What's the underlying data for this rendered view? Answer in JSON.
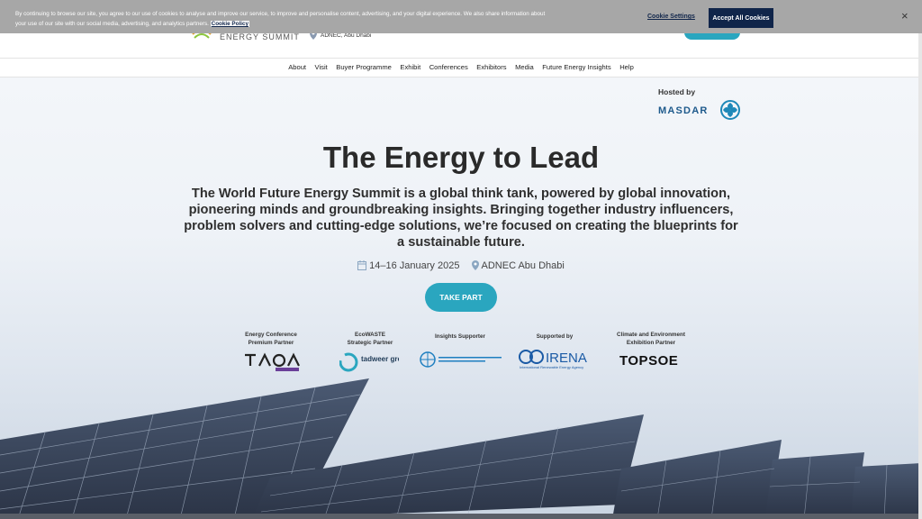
{
  "cookie_banner": {
    "text": "By continuing to browse our site, you agree to our use of cookies to analyse and improve our service, to improve and personalise content, advertising, and your digital experience. We also share information about your use of our site with our social media, advertising, and analytics partners.",
    "policy_link": "Cookie Policy",
    "settings_label": "Cookie Settings",
    "accept_label": "Accept All Cookies",
    "close_label": "×"
  },
  "header": {
    "logo_text": "ENERGY SUMMIT",
    "location": "ADNEC, Abu Dhabi"
  },
  "nav": {
    "items": [
      "About",
      "Visit",
      "Buyer Programme",
      "Exhibit",
      "Conferences",
      "Exhibitors",
      "Media",
      "Future Energy Insights",
      "Help"
    ]
  },
  "host": {
    "label": "Hosted by",
    "name": "MASDAR"
  },
  "hero": {
    "title": "The Energy to Lead",
    "description": "The World Future Energy Summit is a global think tank, powered by global innovation, pioneering minds and groundbreaking insights. Bringing together industry influencers, problem solvers and cutting-edge solutions, we’re focused on creating the blueprints for a sustainable future.",
    "dates": "14–16 January 2025",
    "venue": "ADNEC Abu Dhabi",
    "cta_label": "TAKE PART"
  },
  "partners": [
    {
      "caption_1": "Energy Conference",
      "caption_2": "Premium Partner",
      "logo": "TAQA"
    },
    {
      "caption_1": "EcoWASTE",
      "caption_2": "Strategic Partner",
      "logo": "tadweer group"
    },
    {
      "caption_1": "Insights Supporter",
      "caption_2": "",
      "logo": "UNITED NATIONS INDUSTRIAL DEVELOPMENT ORGANIZATION"
    },
    {
      "caption_1": "Supported by",
      "caption_2": "",
      "logo": "IRENA",
      "logo_sub": "International Renewable Energy Agency"
    },
    {
      "caption_1": "Climate and Environment",
      "caption_2": "Exhibition Partner",
      "logo": "TOPSOE"
    }
  ],
  "colors": {
    "accent": "#2aa6bf",
    "banner_button": "#10254a",
    "masdar_blue": "#1e5a8c"
  }
}
